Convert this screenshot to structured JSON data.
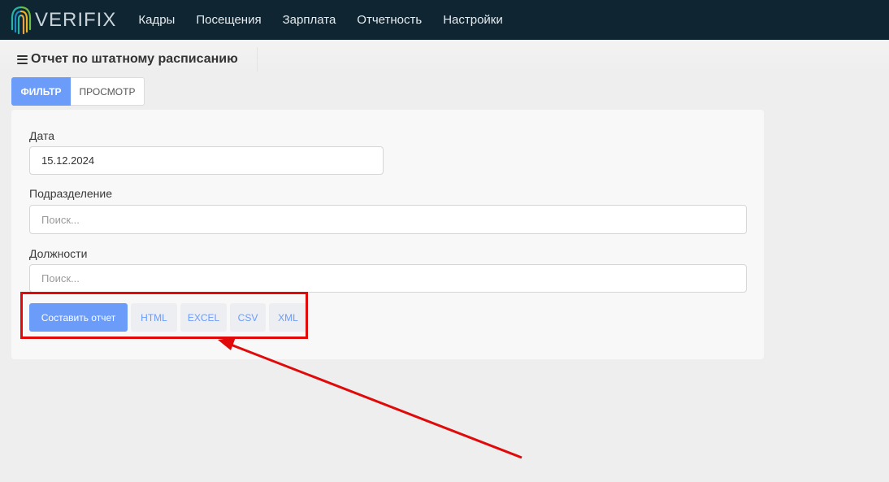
{
  "app": {
    "logo_text": "VERIFIX",
    "brand_color": "#0f2532"
  },
  "nav": {
    "items": [
      {
        "label": "Кадры"
      },
      {
        "label": "Посещения"
      },
      {
        "label": "Зарплата"
      },
      {
        "label": "Отчетность"
      },
      {
        "label": "Настройки"
      }
    ]
  },
  "page": {
    "title": "Отчет по штатному расписанию"
  },
  "tabs": {
    "filter": "ФИЛЬТР",
    "view": "ПРОСМОТР",
    "active": "filter",
    "accent": "#6b9cf9"
  },
  "form": {
    "date_label": "Дата",
    "date_value": "15.12.2024",
    "division_label": "Подразделение",
    "division_placeholder": "Поиск...",
    "positions_label": "Должности",
    "positions_placeholder": "Поиск..."
  },
  "actions": {
    "build_report": "Составить отчет",
    "html": "HTML",
    "excel": "EXCEL",
    "csv": "CSV",
    "xml": "XML"
  },
  "annotation": {
    "color": "#e00a0a"
  }
}
